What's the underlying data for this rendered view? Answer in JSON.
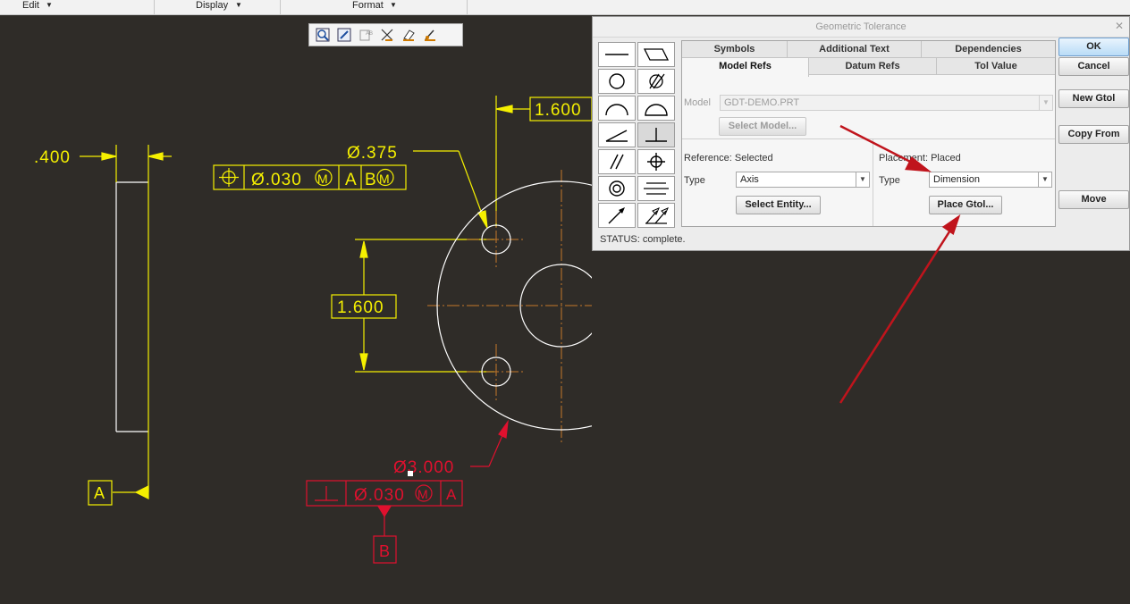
{
  "menubar": {
    "items": [
      {
        "label": "Edit"
      },
      {
        "label": "Display"
      },
      {
        "label": "Format"
      }
    ]
  },
  "drawing": {
    "dim_400": ".400",
    "dim_1600_top": "1.600",
    "dim_1600_left": "1.600",
    "hole_dia": "Ø.375",
    "big_dia": "Ø3.000",
    "fcf_yellow": {
      "tol": "Ø.030",
      "mod": "M",
      "datum_a": "A",
      "datum_b": "B",
      "mod_b": "M"
    },
    "fcf_red": {
      "tol": "Ø.030",
      "mod": "M",
      "datum": "A"
    },
    "datum_a": "A",
    "datum_b": "B"
  },
  "dialog": {
    "title": "Geometric Tolerance",
    "tabs_row1": [
      "Symbols",
      "Additional Text",
      "Dependencies"
    ],
    "tabs_row2": [
      "Model Refs",
      "Datum Refs",
      "Tol Value"
    ],
    "model_label": "Model",
    "model_value": "GDT-DEMO.PRT",
    "select_model_label": "Select Model...",
    "reference_label": "Reference: Selected",
    "ref_type_label": "Type",
    "ref_type_value": "Axis",
    "select_entity_label": "Select Entity...",
    "placement_label": "Placement: Placed",
    "place_type_label": "Type",
    "place_type_value": "Dimension",
    "place_gtol_label": "Place Gtol...",
    "status": "STATUS: complete.",
    "buttons": {
      "ok": "OK",
      "cancel": "Cancel",
      "new_gtol": "New Gtol",
      "copy_from": "Copy From",
      "move": "Move"
    }
  },
  "colors": {
    "yellow": "#f5f000",
    "red": "#e0102e",
    "background": "#2f2c28",
    "centerline": "#c4782a"
  }
}
